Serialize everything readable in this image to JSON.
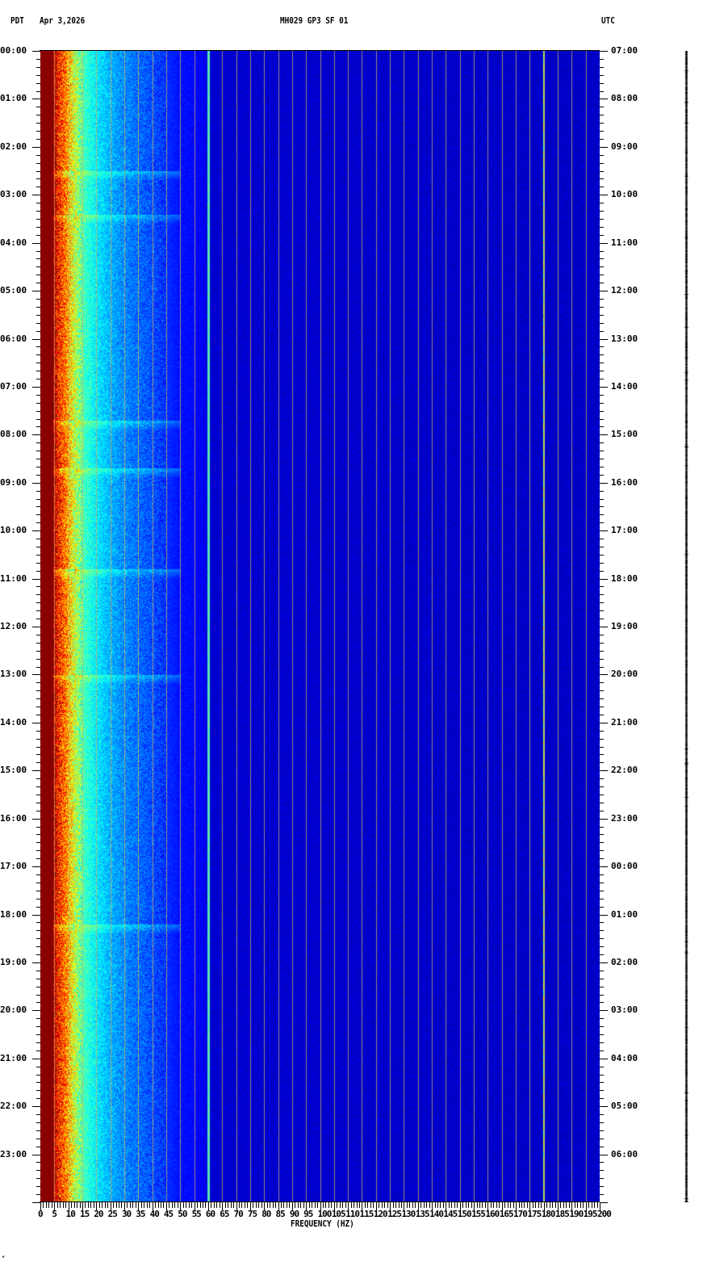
{
  "header": {
    "left_timezone": "PDT",
    "date": "Apr 3,2026",
    "station": "MH029 GP3 SF 01",
    "right_timezone": "UTC"
  },
  "footer_mark": "ʷ",
  "chart_data": {
    "type": "heatmap",
    "title": "MH029 GP3 SF 01",
    "xlabel": "FREQUENCY (HZ)",
    "ylabel_left": "PDT",
    "ylabel_right": "UTC",
    "xlim": [
      0,
      200
    ],
    "ylim_hours": [
      0,
      24
    ],
    "x_ticks": [
      "0",
      "5",
      "10",
      "15",
      "20",
      "25",
      "30",
      "35",
      "40",
      "45",
      "50",
      "55",
      "60",
      "65",
      "70",
      "75",
      "80",
      "85",
      "90",
      "95",
      "100",
      "105",
      "110",
      "115",
      "120",
      "125",
      "130",
      "135",
      "140",
      "145",
      "150",
      "155",
      "160",
      "165",
      "170",
      "175",
      "180",
      "185",
      "190",
      "195",
      "200"
    ],
    "y_ticks_left": [
      "00:00",
      "01:00",
      "02:00",
      "03:00",
      "04:00",
      "05:00",
      "06:00",
      "07:00",
      "08:00",
      "09:00",
      "10:00",
      "11:00",
      "12:00",
      "13:00",
      "14:00",
      "15:00",
      "16:00",
      "17:00",
      "18:00",
      "19:00",
      "20:00",
      "21:00",
      "22:00",
      "23:00"
    ],
    "y_ticks_right": [
      "07:00",
      "08:00",
      "09:00",
      "10:00",
      "11:00",
      "12:00",
      "13:00",
      "14:00",
      "15:00",
      "16:00",
      "17:00",
      "18:00",
      "19:00",
      "20:00",
      "21:00",
      "22:00",
      "23:00",
      "00:00",
      "01:00",
      "02:00",
      "03:00",
      "04:00",
      "05:00",
      "06:00"
    ],
    "colormap": "jet",
    "grid": true,
    "grid_interval_hz": 5,
    "spectral_profile": {
      "freq_hz": [
        0,
        4.5,
        6,
        9,
        12,
        15,
        20,
        25,
        30,
        40,
        50,
        58,
        60,
        200
      ],
      "relative_level": [
        1.0,
        1.0,
        0.86,
        0.75,
        0.58,
        0.45,
        0.36,
        0.3,
        0.26,
        0.2,
        0.14,
        0.12,
        0.08,
        0.07
      ]
    },
    "narrowband_lines_hz": [
      60,
      180
    ],
    "broadband_events_hours": [
      2.5,
      3.4,
      7.7,
      8.7,
      10.8,
      13.0,
      18.2
    ]
  }
}
